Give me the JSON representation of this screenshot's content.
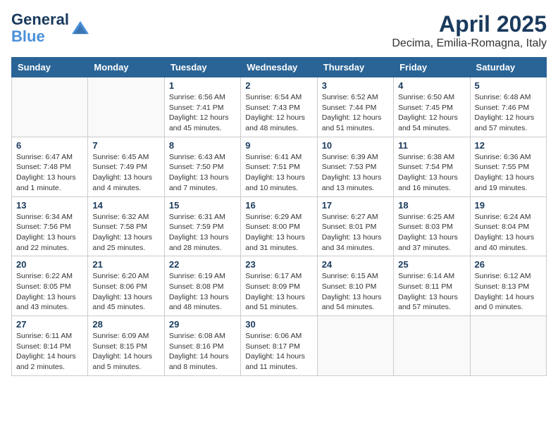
{
  "logo": {
    "line1": "General",
    "line2": "Blue"
  },
  "title": "April 2025",
  "location": "Decima, Emilia-Romagna, Italy",
  "headers": [
    "Sunday",
    "Monday",
    "Tuesday",
    "Wednesday",
    "Thursday",
    "Friday",
    "Saturday"
  ],
  "weeks": [
    [
      {
        "day": "",
        "detail": ""
      },
      {
        "day": "",
        "detail": ""
      },
      {
        "day": "1",
        "detail": "Sunrise: 6:56 AM\nSunset: 7:41 PM\nDaylight: 12 hours and 45 minutes."
      },
      {
        "day": "2",
        "detail": "Sunrise: 6:54 AM\nSunset: 7:43 PM\nDaylight: 12 hours and 48 minutes."
      },
      {
        "day": "3",
        "detail": "Sunrise: 6:52 AM\nSunset: 7:44 PM\nDaylight: 12 hours and 51 minutes."
      },
      {
        "day": "4",
        "detail": "Sunrise: 6:50 AM\nSunset: 7:45 PM\nDaylight: 12 hours and 54 minutes."
      },
      {
        "day": "5",
        "detail": "Sunrise: 6:48 AM\nSunset: 7:46 PM\nDaylight: 12 hours and 57 minutes."
      }
    ],
    [
      {
        "day": "6",
        "detail": "Sunrise: 6:47 AM\nSunset: 7:48 PM\nDaylight: 13 hours and 1 minute."
      },
      {
        "day": "7",
        "detail": "Sunrise: 6:45 AM\nSunset: 7:49 PM\nDaylight: 13 hours and 4 minutes."
      },
      {
        "day": "8",
        "detail": "Sunrise: 6:43 AM\nSunset: 7:50 PM\nDaylight: 13 hours and 7 minutes."
      },
      {
        "day": "9",
        "detail": "Sunrise: 6:41 AM\nSunset: 7:51 PM\nDaylight: 13 hours and 10 minutes."
      },
      {
        "day": "10",
        "detail": "Sunrise: 6:39 AM\nSunset: 7:53 PM\nDaylight: 13 hours and 13 minutes."
      },
      {
        "day": "11",
        "detail": "Sunrise: 6:38 AM\nSunset: 7:54 PM\nDaylight: 13 hours and 16 minutes."
      },
      {
        "day": "12",
        "detail": "Sunrise: 6:36 AM\nSunset: 7:55 PM\nDaylight: 13 hours and 19 minutes."
      }
    ],
    [
      {
        "day": "13",
        "detail": "Sunrise: 6:34 AM\nSunset: 7:56 PM\nDaylight: 13 hours and 22 minutes."
      },
      {
        "day": "14",
        "detail": "Sunrise: 6:32 AM\nSunset: 7:58 PM\nDaylight: 13 hours and 25 minutes."
      },
      {
        "day": "15",
        "detail": "Sunrise: 6:31 AM\nSunset: 7:59 PM\nDaylight: 13 hours and 28 minutes."
      },
      {
        "day": "16",
        "detail": "Sunrise: 6:29 AM\nSunset: 8:00 PM\nDaylight: 13 hours and 31 minutes."
      },
      {
        "day": "17",
        "detail": "Sunrise: 6:27 AM\nSunset: 8:01 PM\nDaylight: 13 hours and 34 minutes."
      },
      {
        "day": "18",
        "detail": "Sunrise: 6:25 AM\nSunset: 8:03 PM\nDaylight: 13 hours and 37 minutes."
      },
      {
        "day": "19",
        "detail": "Sunrise: 6:24 AM\nSunset: 8:04 PM\nDaylight: 13 hours and 40 minutes."
      }
    ],
    [
      {
        "day": "20",
        "detail": "Sunrise: 6:22 AM\nSunset: 8:05 PM\nDaylight: 13 hours and 43 minutes."
      },
      {
        "day": "21",
        "detail": "Sunrise: 6:20 AM\nSunset: 8:06 PM\nDaylight: 13 hours and 45 minutes."
      },
      {
        "day": "22",
        "detail": "Sunrise: 6:19 AM\nSunset: 8:08 PM\nDaylight: 13 hours and 48 minutes."
      },
      {
        "day": "23",
        "detail": "Sunrise: 6:17 AM\nSunset: 8:09 PM\nDaylight: 13 hours and 51 minutes."
      },
      {
        "day": "24",
        "detail": "Sunrise: 6:15 AM\nSunset: 8:10 PM\nDaylight: 13 hours and 54 minutes."
      },
      {
        "day": "25",
        "detail": "Sunrise: 6:14 AM\nSunset: 8:11 PM\nDaylight: 13 hours and 57 minutes."
      },
      {
        "day": "26",
        "detail": "Sunrise: 6:12 AM\nSunset: 8:13 PM\nDaylight: 14 hours and 0 minutes."
      }
    ],
    [
      {
        "day": "27",
        "detail": "Sunrise: 6:11 AM\nSunset: 8:14 PM\nDaylight: 14 hours and 2 minutes."
      },
      {
        "day": "28",
        "detail": "Sunrise: 6:09 AM\nSunset: 8:15 PM\nDaylight: 14 hours and 5 minutes."
      },
      {
        "day": "29",
        "detail": "Sunrise: 6:08 AM\nSunset: 8:16 PM\nDaylight: 14 hours and 8 minutes."
      },
      {
        "day": "30",
        "detail": "Sunrise: 6:06 AM\nSunset: 8:17 PM\nDaylight: 14 hours and 11 minutes."
      },
      {
        "day": "",
        "detail": ""
      },
      {
        "day": "",
        "detail": ""
      },
      {
        "day": "",
        "detail": ""
      }
    ]
  ]
}
